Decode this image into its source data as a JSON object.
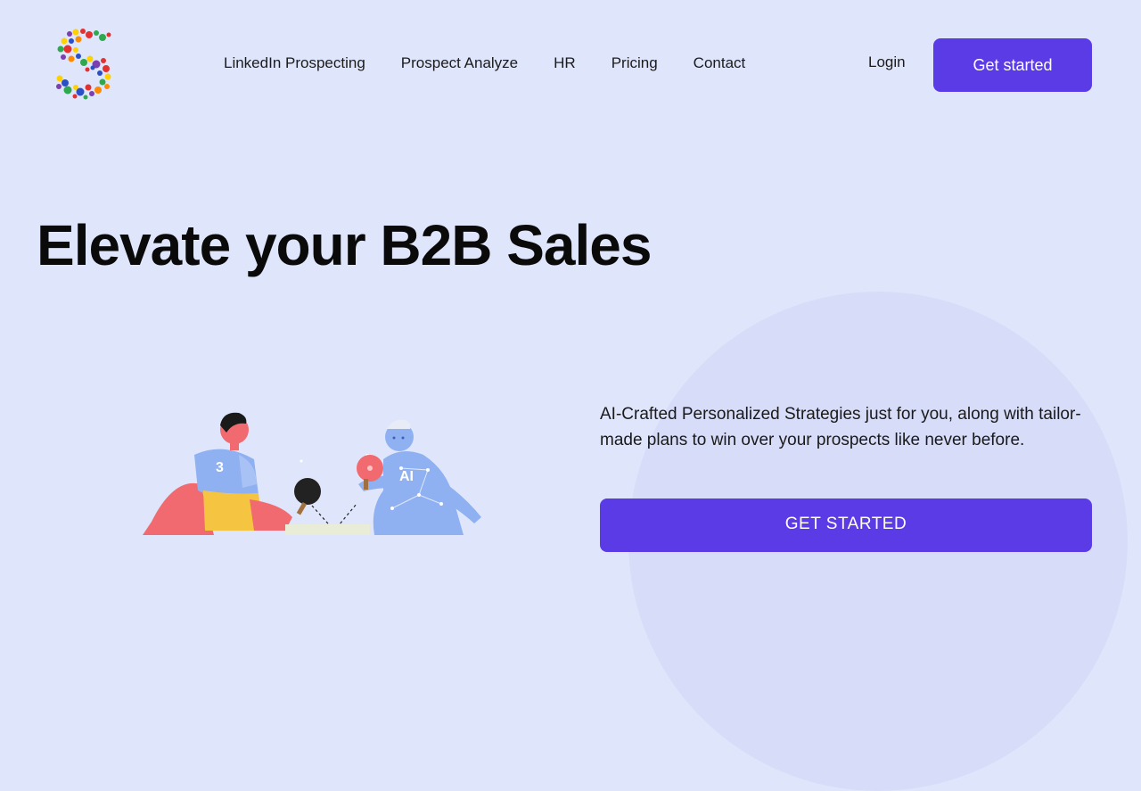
{
  "brand": {
    "logo_icon": "dotted-s-logo-icon",
    "colors": {
      "background": "#dfe6fb",
      "accent": "#5b3be6",
      "circle": "#d7dcf9"
    }
  },
  "nav": {
    "items": [
      {
        "label": "LinkedIn Prospecting"
      },
      {
        "label": "Prospect Analyze"
      },
      {
        "label": "HR"
      },
      {
        "label": "Pricing"
      },
      {
        "label": "Contact"
      }
    ],
    "login_label": "Login",
    "get_started_label": "Get started"
  },
  "hero": {
    "title": "Elevate your B2B Sales",
    "description": "AI-Crafted Personalized Strategies just for you, along with tailor-made plans to win over your prospects like never before.",
    "cta_label": "GET STARTED",
    "illustration": {
      "player_number": "3",
      "robot_label": "AI"
    }
  }
}
